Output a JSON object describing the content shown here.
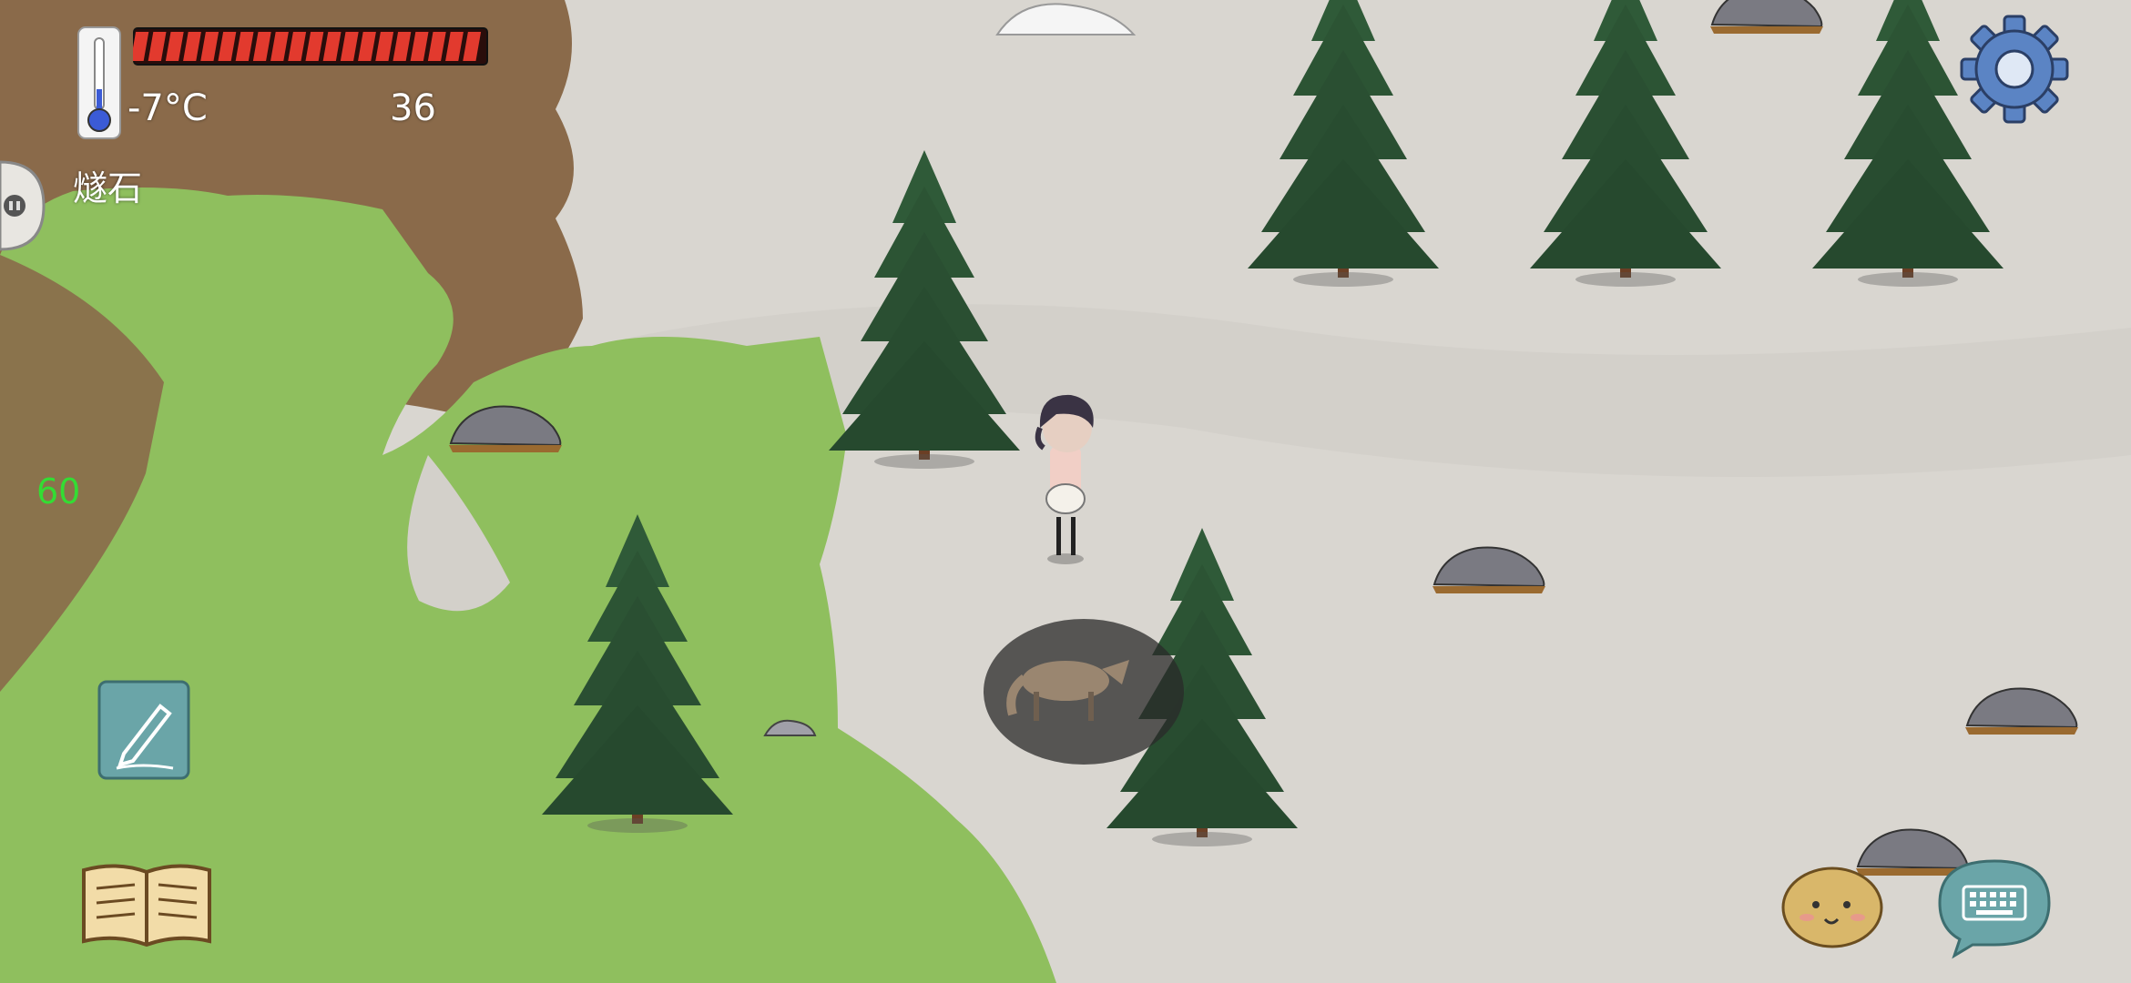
{
  "hud": {
    "temperature": "-7°C",
    "food_count": "36",
    "held_item": "燧石",
    "fps": "60",
    "food_meter_level": 1.0,
    "food_meter_segments": 20
  },
  "icons": {
    "thermometer": "thermometer-icon",
    "settings": "gear-icon",
    "note": "pencil-note-icon",
    "book": "open-book-icon",
    "emote": "potato-face-icon",
    "chat": "keyboard-chat-icon"
  },
  "colors": {
    "grass": "#8fbf5e",
    "dirt": "#8a6a4a",
    "snow": "#d9d6d0",
    "food_bar": "#e23a2e",
    "fps_text": "#33dd33",
    "tree": "#2f5a38",
    "trunk": "#6b3f25"
  }
}
